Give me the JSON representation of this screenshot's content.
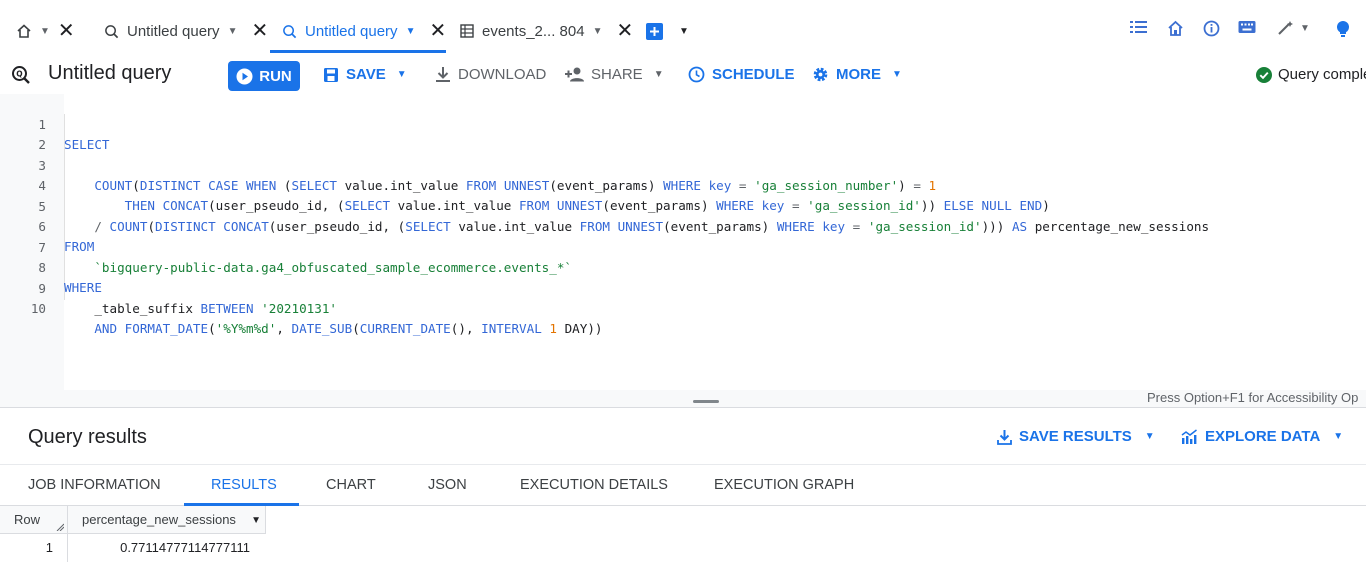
{
  "tabs": [
    {
      "label": "Untitled query",
      "icon": "search-query-icon"
    },
    {
      "label": "Untitled query",
      "icon": "search-query-icon"
    },
    {
      "label": "events_2... 804",
      "icon": "table-icon"
    }
  ],
  "query": {
    "title": "Untitled query",
    "status": "Query comple"
  },
  "toolbar": {
    "run": "RUN",
    "save": "SAVE",
    "download": "DOWNLOAD",
    "share": "SHARE",
    "schedule": "SCHEDULE",
    "more": "MORE"
  },
  "editor": {
    "line_numbers": [
      "1",
      "2",
      "3",
      "4",
      "5",
      "6",
      "7",
      "8",
      "9",
      "10"
    ],
    "accessibility_hint": "Press Option+F1 for Accessibility Op"
  },
  "results": {
    "title": "Query results",
    "save_results": "SAVE RESULTS",
    "explore_data": "EXPLORE DATA",
    "tabs": [
      "JOB INFORMATION",
      "RESULTS",
      "CHART",
      "JSON",
      "EXECUTION DETAILS",
      "EXECUTION GRAPH"
    ],
    "columns": [
      "Row",
      "percentage_new_sessions"
    ],
    "rows": [
      {
        "row": "1",
        "value": "0.77114777114777111"
      }
    ]
  },
  "colors": {
    "accent": "#1a73e8",
    "keyword": "#3367d6",
    "string": "#188038",
    "number": "#e37400",
    "success": "#188038"
  }
}
